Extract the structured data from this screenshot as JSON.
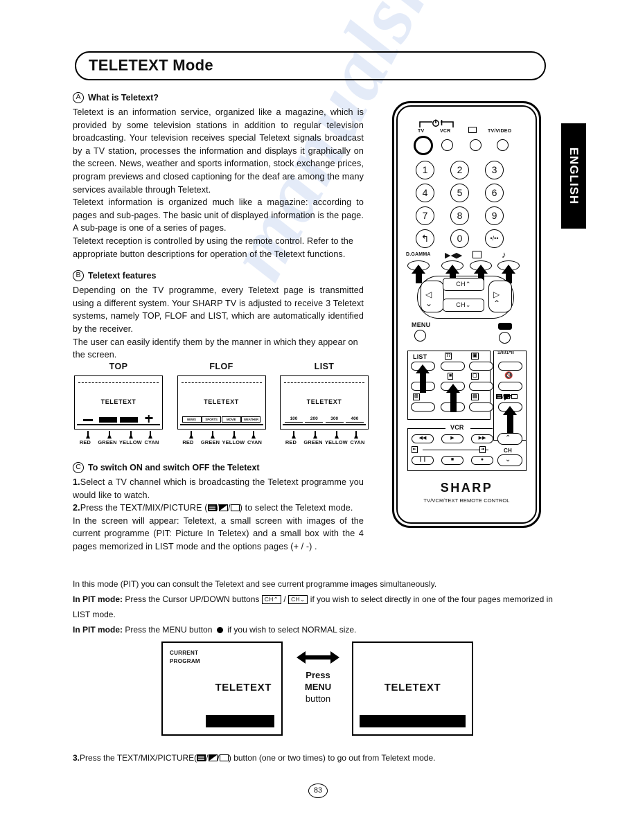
{
  "document": {
    "title": "TELETEXT Mode",
    "language_tab": "ENGLISH",
    "page_number": "83",
    "watermark": "manualshive"
  },
  "sections": {
    "a": {
      "marker": "A",
      "heading": "What is Teletext?",
      "paragraphs": [
        "Teletext is an information service, organized like a magazine, which is provided by  some television stations in addition to regular television broadcasting. Your television receives special Teletext signals broadcast by a TV station, processes the information and displays it graphically on the screen. News, weather and sports information, stock exchange prices, program previews and closed captioning for  the deaf are among the many services available through Teletext.",
        "Teletext information is organized much like a magazine: according to pages and sub-pages. The basic unit of displayed information is the page. A sub-page is one of a series of pages.",
        "Teletext reception is controlled by using the remote control. Refer to the appropriate button descriptions for operation of the Teletext functions."
      ]
    },
    "b": {
      "marker": "B",
      "heading": "Teletext features",
      "paragraphs": [
        "Depending on the TV programme, every Teletext page is transmitted using a different system. Your SHARP TV is adjusted to receive 3 Teletext systems, namely TOP, FLOF and LIST, which are automatically identified by the receiver.",
        "The user can easily identify them by the manner in which they appear on the screen."
      ]
    },
    "c": {
      "marker": "C",
      "heading": "To switch ON and switch OFF the Teletext",
      "step1_num": "1.",
      "step1": "Select a TV channel which is broadcasting the Teletext programme you would like to watch.",
      "step2_num": "2.",
      "step2_pre": "Press the TEXT/MIX/PICTURE (",
      "step2_post": ") to select the Teletext mode.",
      "para": "In the screen will appear: Teletext,  a small screen with images of the current programme (PIT: Picture In Teletex) and a small box with the 4 pages memorized in LIST mode and the options pages (+ / -) ."
    }
  },
  "mode_diagrams": {
    "screen_label": "TELETEXT",
    "color_labels": [
      "RED",
      "GREEN",
      "YELLOW",
      "CYAN"
    ],
    "items": [
      {
        "title": "TOP",
        "kind": "marks",
        "cells": [
          "dash",
          "block",
          "block",
          "plus"
        ]
      },
      {
        "title": "FLOF",
        "kind": "boxes",
        "cells": [
          "NEWS",
          "SPORTS",
          "MOVIE",
          "WEATHER"
        ]
      },
      {
        "title": "LIST",
        "kind": "pages",
        "cells": [
          "100",
          "200",
          "300",
          "400"
        ]
      }
    ]
  },
  "pit_notes": {
    "line1": "In this mode (PIT) you can consult the Teletext and see current programme images simultaneously.",
    "line2_label": "In PIT mode:",
    "line2_pre": "Press the Cursor UP/DOWN buttons",
    "key_up": "CH",
    "key_down": "CH",
    "line2_mid": "/",
    "line2_post": "if you wish to select directly in one of the four pages memorized in LIST mode.",
    "line3_label": "In PIT mode:",
    "line3_pre": "Press the MENU button",
    "line3_post": "if you wish to select NORMAL size."
  },
  "menu_demo": {
    "left_screen": {
      "corner_line1": "CURRENT",
      "corner_line2": "PROGRAM",
      "center": "TELETEXT"
    },
    "right_screen": {
      "center": "TELETEXT"
    },
    "caption_line1": "Press",
    "caption_line2": "MENU",
    "caption_line3": "button"
  },
  "final_step": {
    "num": "3.",
    "pre": "Press the TEXT/MIX/PICTURE(",
    "post": ") button (one or two times) to go out from Teletext mode."
  },
  "remote": {
    "brand": "SHARP",
    "subtitle": "TV/VCR/TEXT REMOTE CONTROL",
    "power_row": {
      "tv": "TV",
      "vcr": "VCR",
      "tv_video": "TV/VIDEO"
    },
    "numbers": [
      "1",
      "2",
      "3",
      "4",
      "5",
      "6",
      "7",
      "8",
      "9",
      "0"
    ],
    "feature_row": {
      "dgamma": "D.GAMMA"
    },
    "ch_up": "CH",
    "ch_down": "CH",
    "menu": "MENU",
    "list": "LIST",
    "sound_mode": "1/II/1*II",
    "vcr_label": "VCR",
    "ch_label": "CH"
  }
}
